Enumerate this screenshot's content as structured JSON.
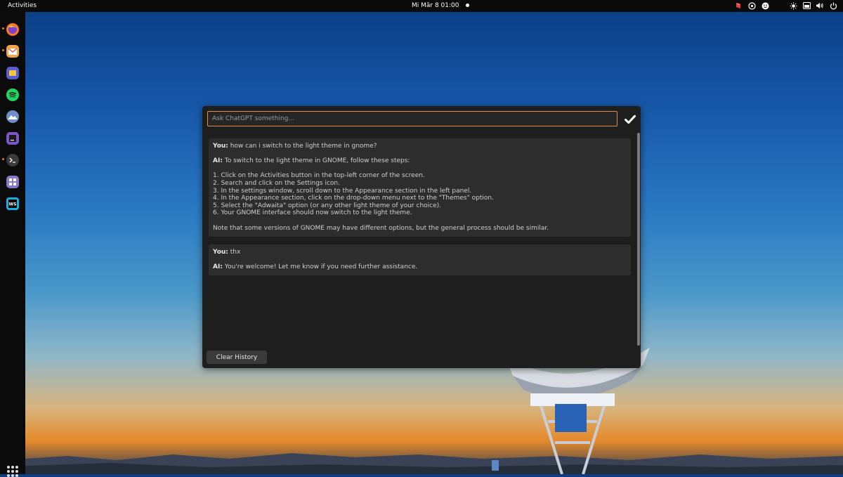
{
  "topbar": {
    "activities": "Activities",
    "clock": "Mi Mär 8  01:00",
    "tray_icons": [
      "app-indicator-icon",
      "accessibility-icon",
      "emoji-icon",
      "brightness-icon",
      "screen-icon",
      "volume-icon",
      "power-icon"
    ]
  },
  "dock": {
    "apps": [
      "firefox-icon",
      "mail-icon",
      "files-icon",
      "spotify-icon",
      "image-viewer-icon",
      "ide-icon",
      "terminal-icon",
      "tweaks-icon",
      "webstorm-icon"
    ],
    "webstorm_label": "WS"
  },
  "popup": {
    "input_placeholder": "Ask ChatGPT something...",
    "messages": [
      {
        "you_label": "You:",
        "you_text": " how can i switch to the light theme in gnome?",
        "ai_label": "AI:",
        "ai_lines": [
          " To switch to the light theme in GNOME, follow these steps:",
          "",
          "1. Click on the Activities button in the top-left corner of the screen.",
          "2. Search and click on the Settings icon.",
          "3. In the settings window, scroll down to the Appearance section in the left panel.",
          "4. In the Appearance section, click on the drop-down menu next to the \"Themes\" option.",
          "5. Select the \"Adwaita\" option (or any other light theme of your choice).",
          "6. Your GNOME interface should now switch to the light theme.",
          "",
          "Note that some versions of GNOME may have different options, but the general process should be similar."
        ]
      },
      {
        "you_label": "You:",
        "you_text": " thx",
        "ai_label": "AI:",
        "ai_lines": [
          " You're welcome! Let me know if you need further assistance."
        ]
      }
    ],
    "clear_button": "Clear History"
  },
  "colors": {
    "accent_border": "#e58b55",
    "popup_bg": "#1e1e1e",
    "message_bg": "#2d2d2d"
  }
}
